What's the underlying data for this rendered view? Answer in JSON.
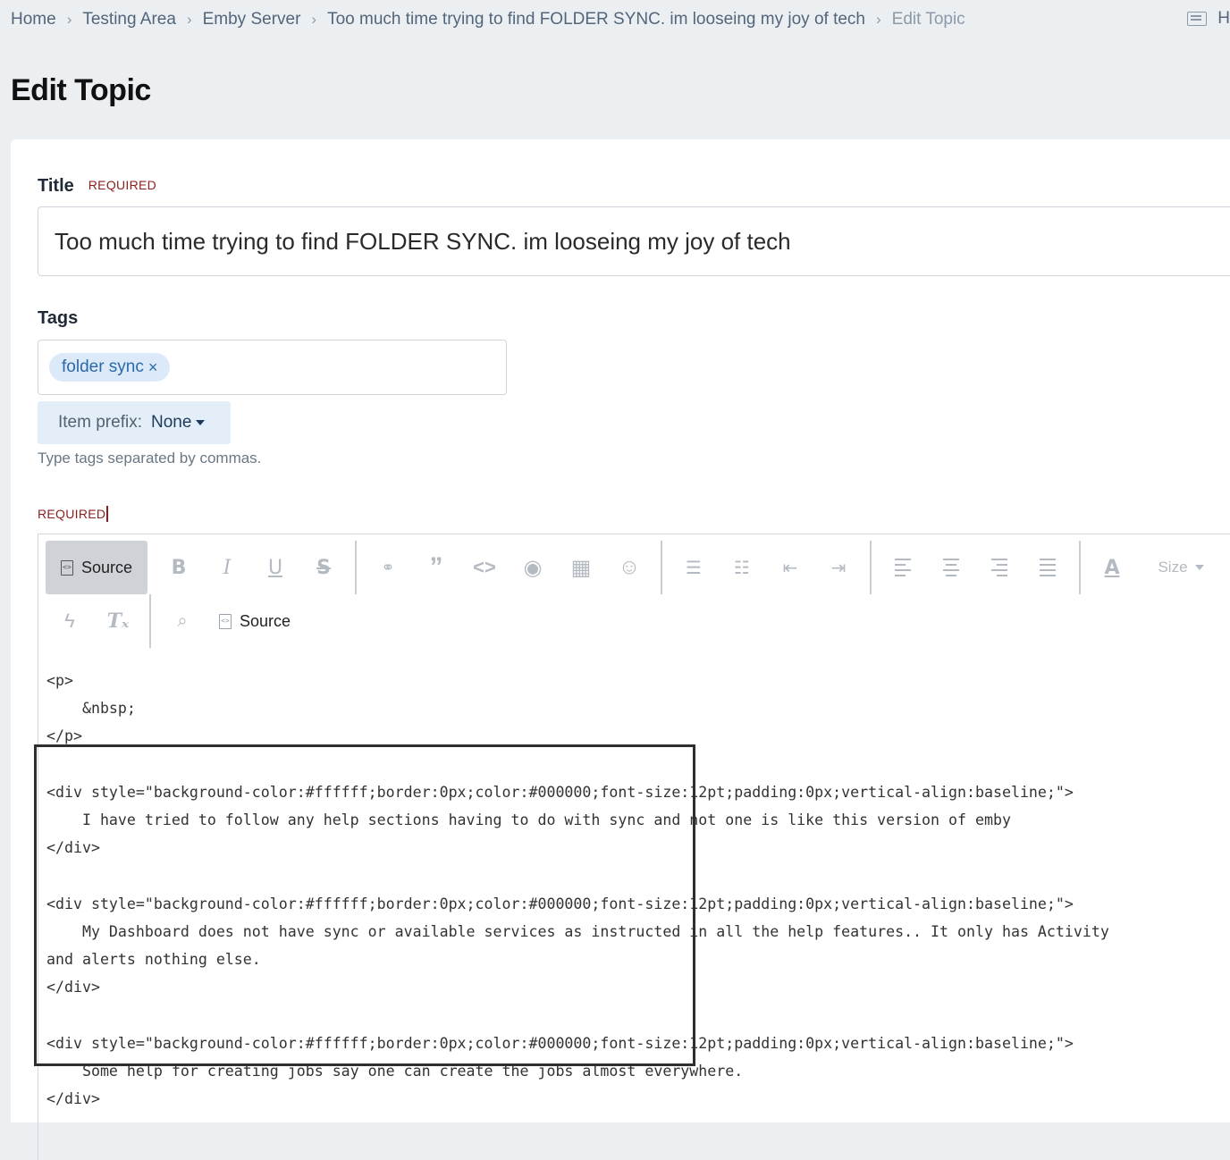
{
  "breadcrumb": {
    "items": [
      "Home",
      "Testing Area",
      "Emby Server",
      "Too much time trying to find FOLDER SYNC. im looseing my joy of tech"
    ],
    "current": "Edit Topic"
  },
  "top_right": {
    "label": "H"
  },
  "page": {
    "title": "Edit Topic"
  },
  "form": {
    "title_label": "Title",
    "required": "REQUIRED",
    "title_value": "Too much time trying to find FOLDER SYNC. im looseing my joy of tech",
    "tags_label": "Tags",
    "tags": [
      {
        "label": "folder sync",
        "remove": "×"
      }
    ],
    "item_prefix_label": "Item prefix:",
    "item_prefix_value": "None",
    "tags_hint": "Type tags separated by commas.",
    "content_required": "REQUIRED"
  },
  "editor": {
    "source_label": "Source",
    "size_label": "Size",
    "source_label_2": "Source",
    "icons": [
      "source-icon",
      "bold-icon",
      "italic-icon",
      "underline-icon",
      "strikethrough-icon",
      "link-icon",
      "quote-icon",
      "code-icon",
      "preview-icon",
      "table-icon",
      "emoji-icon",
      "bullet-list-icon",
      "numbered-list-icon",
      "outdent-icon",
      "indent-icon",
      "align-left-icon",
      "align-center-icon",
      "align-right-icon",
      "justify-icon",
      "text-color-icon",
      "flash-icon",
      "clear-format-icon",
      "find-icon"
    ],
    "code_lines": [
      "<p>",
      "    &nbsp;",
      "</p>",
      "",
      "<div style=\"background-color:#ffffff;border:0px;color:#000000;font-size:12pt;padding:0px;vertical-align:baseline;\">",
      "    I have tried to follow any help sections having to do with sync and not one is like this version of emby",
      "</div>",
      "",
      "<div style=\"background-color:#ffffff;border:0px;color:#000000;font-size:12pt;padding:0px;vertical-align:baseline;\">",
      "    My Dashboard does not have sync or available services as instructed in all the help features.. It only has Activity",
      "and alerts nothing else.",
      "</div>",
      "",
      "<div style=\"background-color:#ffffff;border:0px;color:#000000;font-size:12pt;padding:0px;vertical-align:baseline;\">",
      "    Some help for creating jobs say one can create the jobs almost everywhere.",
      "</div>"
    ]
  }
}
